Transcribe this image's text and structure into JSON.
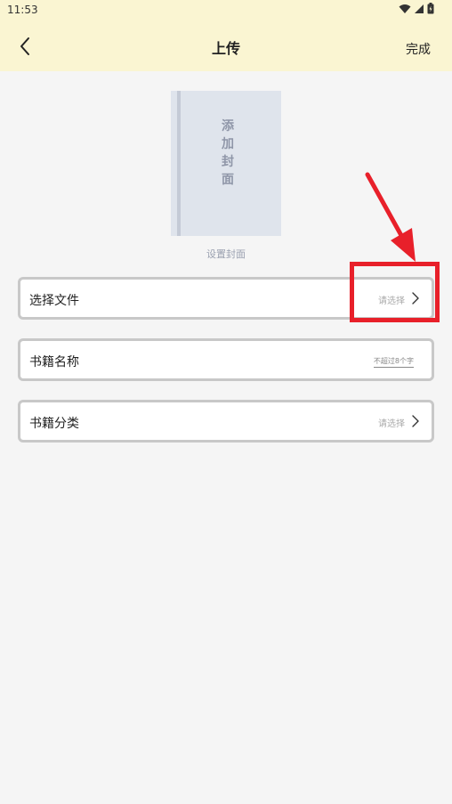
{
  "status_bar": {
    "time": "11:53",
    "icons": [
      "wifi-icon",
      "signal-icon",
      "battery-icon"
    ]
  },
  "header": {
    "back_icon": "chevron-left-icon",
    "title": "上传",
    "done_label": "完成"
  },
  "cover": {
    "placeholder_lines": [
      "添",
      "加",
      "封",
      "面"
    ],
    "caption": "设置封面"
  },
  "form": {
    "file": {
      "label": "选择文件",
      "value": "请选择"
    },
    "name": {
      "label": "书籍名称",
      "placeholder": "不超过8个字"
    },
    "category": {
      "label": "书籍分类",
      "value": "请选择"
    }
  },
  "colors": {
    "header_bg": "#faf5d2",
    "page_bg": "#f5f5f5",
    "annotation": "#e8202a"
  }
}
